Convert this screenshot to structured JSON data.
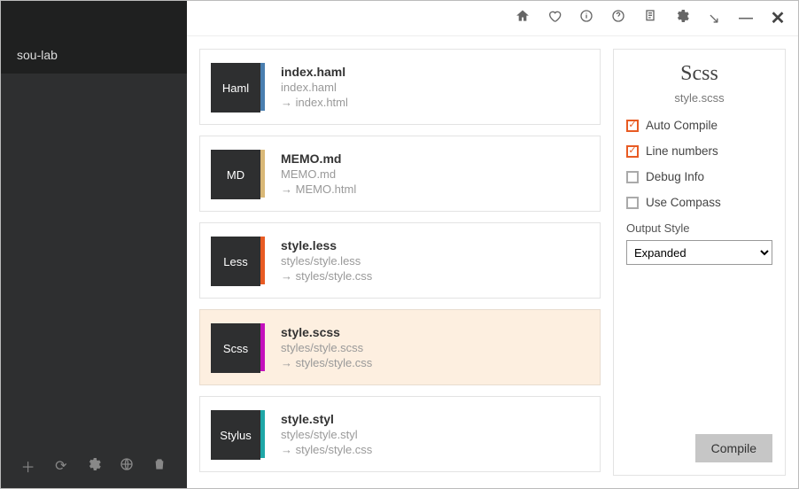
{
  "sidebar": {
    "project": "sou-lab"
  },
  "files": [
    {
      "type": "Haml",
      "typeClass": "haml",
      "name": "index.haml",
      "path": "index.haml",
      "out": "index.html",
      "selected": false
    },
    {
      "type": "MD",
      "typeClass": "md",
      "name": "MEMO.md",
      "path": "MEMO.md",
      "out": "MEMO.html",
      "selected": false
    },
    {
      "type": "Less",
      "typeClass": "less",
      "name": "style.less",
      "path": "styles/style.less",
      "out": "styles/style.css",
      "selected": false
    },
    {
      "type": "Scss",
      "typeClass": "scss",
      "name": "style.scss",
      "path": "styles/style.scss",
      "out": "styles/style.css",
      "selected": true
    },
    {
      "type": "Stylus",
      "typeClass": "stylus",
      "name": "style.styl",
      "path": "styles/style.styl",
      "out": "styles/style.css",
      "selected": false
    }
  ],
  "panel": {
    "title": "Scss",
    "file": "style.scss",
    "options": [
      {
        "label": "Auto Compile",
        "checked": true
      },
      {
        "label": "Line numbers",
        "checked": true
      },
      {
        "label": "Debug Info",
        "checked": false
      },
      {
        "label": "Use Compass",
        "checked": false
      }
    ],
    "outputStyleLabel": "Output Style",
    "outputStyle": "Expanded",
    "compileLabel": "Compile"
  }
}
